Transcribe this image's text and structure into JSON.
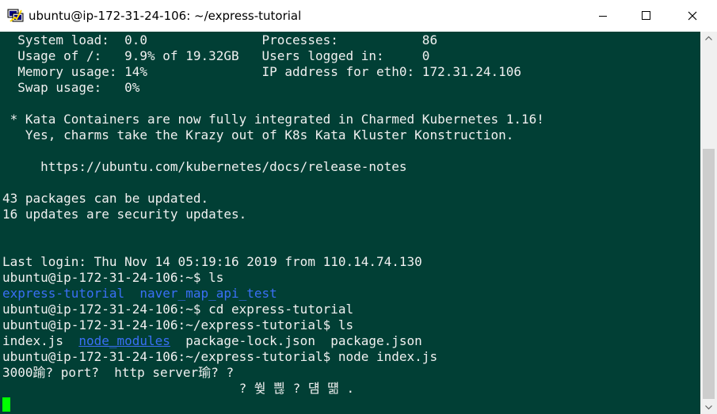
{
  "window": {
    "title": "ubuntu@ip-172-31-24-106: ~/express-tutorial",
    "icon": "putty-icon"
  },
  "controls": {
    "minimize": "minimize-icon",
    "maximize": "maximize-icon",
    "close": "close-icon"
  },
  "terminal": {
    "lines": [
      [
        {
          "t": "  System load:  0.0               Processes:           86"
        }
      ],
      [
        {
          "t": "  Usage of /:   9.9% of 19.32GB   Users logged in:     0"
        }
      ],
      [
        {
          "t": "  Memory usage: 14%               IP address for eth0: 172.31.24.106"
        }
      ],
      [
        {
          "t": "  Swap usage:   0%"
        }
      ],
      [
        {
          "t": ""
        }
      ],
      [
        {
          "t": " * Kata Containers are now fully integrated in Charmed Kubernetes 1.16!"
        }
      ],
      [
        {
          "t": "   Yes, charms take the Krazy out of K8s Kata Kluster Konstruction."
        }
      ],
      [
        {
          "t": ""
        }
      ],
      [
        {
          "t": "     https://ubuntu.com/kubernetes/docs/release-notes"
        }
      ],
      [
        {
          "t": ""
        }
      ],
      [
        {
          "t": "43 packages can be updated."
        }
      ],
      [
        {
          "t": "16 updates are security updates."
        }
      ],
      [
        {
          "t": ""
        }
      ],
      [
        {
          "t": ""
        }
      ],
      [
        {
          "t": "Last login: Thu Nov 14 05:19:16 2019 from 110.14.74.130"
        }
      ],
      [
        {
          "t": "ubuntu@ip-172-31-24-106:~$ ls"
        }
      ],
      [
        {
          "t": "express-tutorial",
          "c": "blue"
        },
        {
          "t": "  "
        },
        {
          "t": "naver_map_api_test",
          "c": "blue"
        }
      ],
      [
        {
          "t": "ubuntu@ip-172-31-24-106:~$ cd express-tutorial"
        }
      ],
      [
        {
          "t": "ubuntu@ip-172-31-24-106:~/express-tutorial$ ls"
        }
      ],
      [
        {
          "t": "index.js  "
        },
        {
          "t": "node_modules",
          "c": "blue uline"
        },
        {
          "t": "  package-lock.json  package.json"
        }
      ],
      [
        {
          "t": "ubuntu@ip-172-31-24-106:~/express-tutorial$ node index.js"
        }
      ],
      [
        {
          "t": "3000踰? port?  http server瑜? ?"
        }
      ],
      [
        {
          "t": "                               ? 쒖 쁺 ? 덈 떎 ."
        }
      ]
    ]
  },
  "cursor_color": "#00ff00",
  "colors": {
    "terminal_bg": "#013f35",
    "terminal_fg": "#f0f0f0",
    "directory": "#3a6ff5"
  }
}
